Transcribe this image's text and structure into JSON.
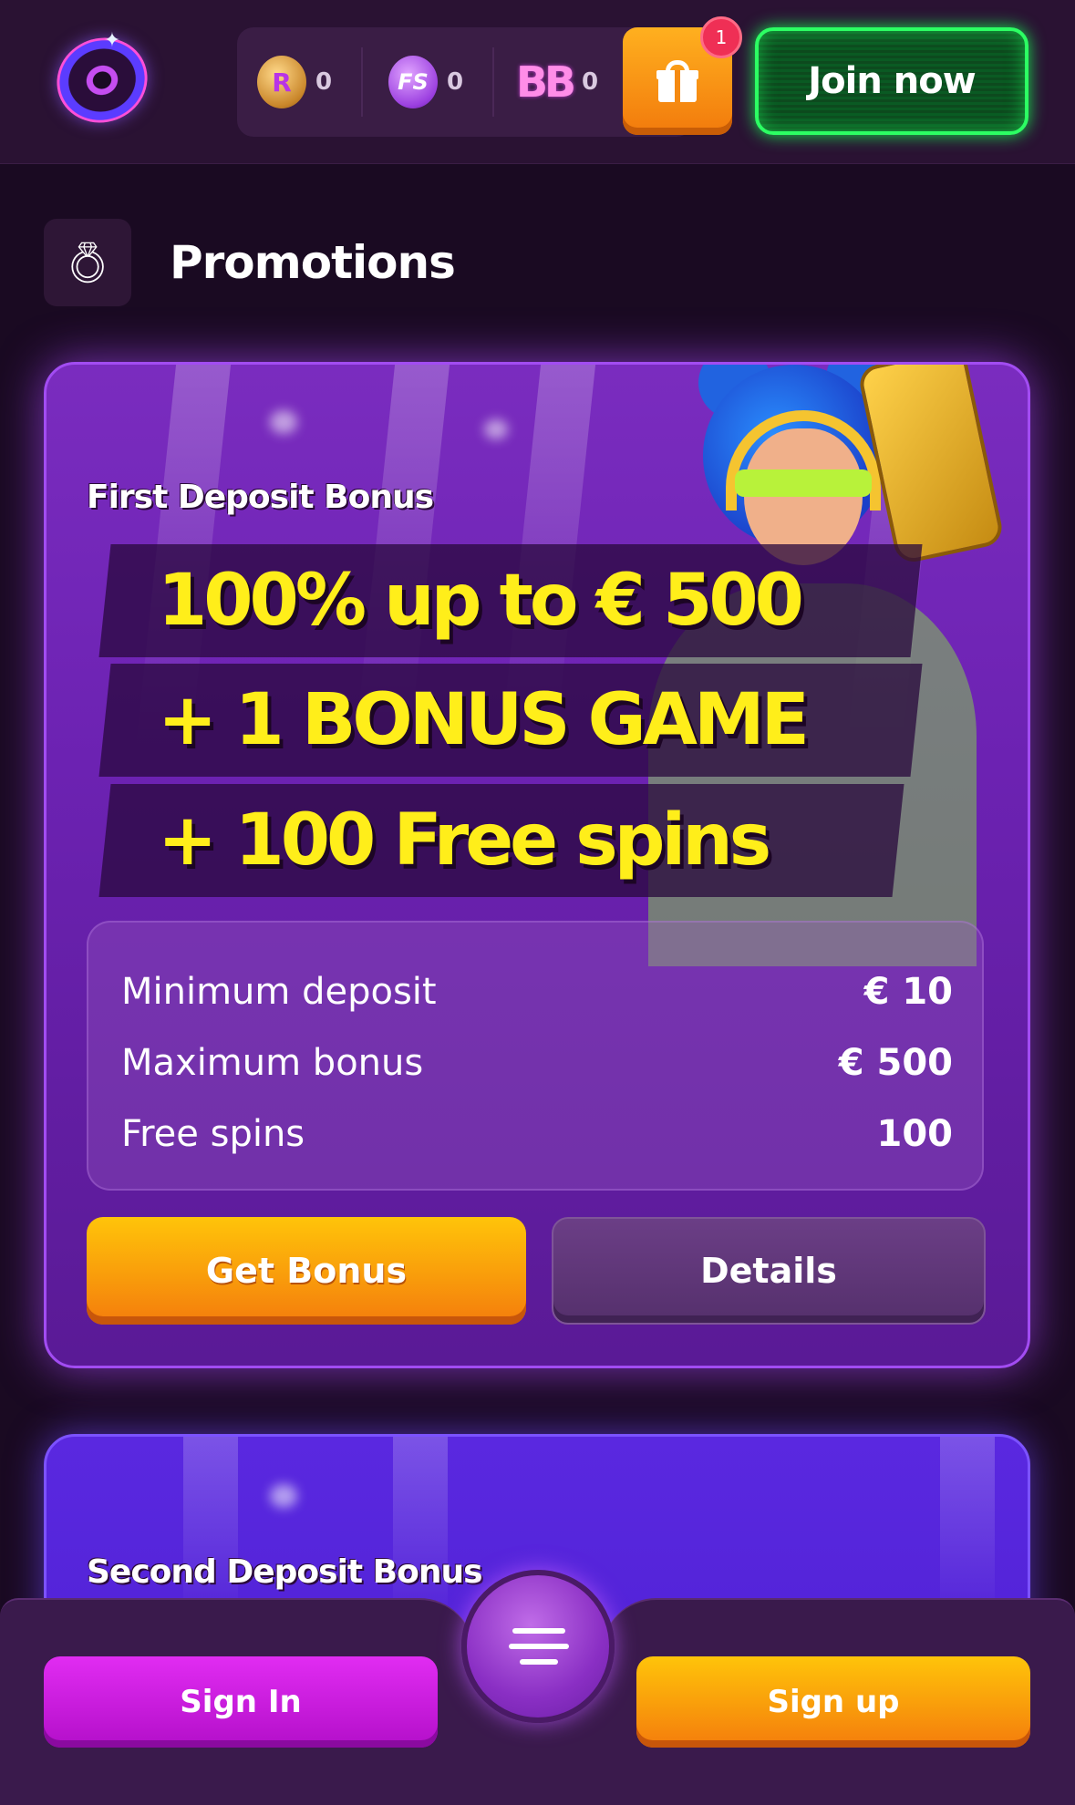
{
  "header": {
    "balances": [
      {
        "icon": "r-coin-icon",
        "letter": "R",
        "value": "0"
      },
      {
        "icon": "fs-coin-icon",
        "letter": "FS",
        "value": "0"
      },
      {
        "icon": "bb-icon",
        "letter": "BB",
        "value": "0"
      }
    ],
    "gift_notification_count": "1",
    "join_label": "Join now"
  },
  "page": {
    "title": "Promotions",
    "title_icon": "ring-icon"
  },
  "promotions": [
    {
      "name": "First Deposit Bonus",
      "headline": [
        "100% up to € 500",
        "+ 1 BONUS GAME",
        "+ 100 Free spins"
      ],
      "details": [
        {
          "label": "Minimum deposit",
          "value": "€ 10"
        },
        {
          "label": "Maximum bonus",
          "value": "€ 500"
        },
        {
          "label": "Free spins",
          "value": "100"
        }
      ],
      "primary_label": "Get Bonus",
      "secondary_label": "Details"
    },
    {
      "name": "Second Deposit Bonus"
    }
  ],
  "bottom_bar": {
    "signin_label": "Sign In",
    "signup_label": "Sign up",
    "menu_icon": "menu-icon"
  },
  "colors": {
    "background": "#1a0a22",
    "card_purple": "#6c22b2",
    "accent_yellow": "#ffee1a",
    "join_green": "#2cff63",
    "orange_button": "#f47c0c",
    "magenta_button": "#e12cf2"
  }
}
